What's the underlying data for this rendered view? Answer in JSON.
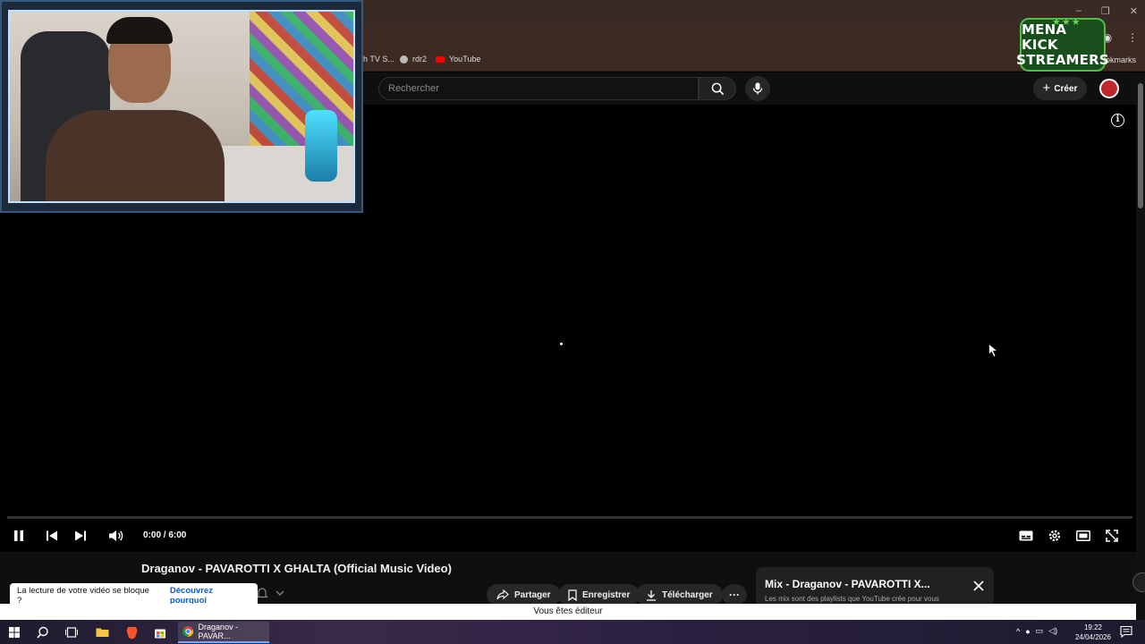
{
  "browser": {
    "bookmarks": [
      {
        "label": "h TV S..."
      },
      {
        "label": "rdr2"
      },
      {
        "label": "YouTube"
      }
    ],
    "bookmarks_right": "ookmarks"
  },
  "youtube": {
    "search_placeholder": "Rechercher",
    "create_label": "Créer"
  },
  "player": {
    "time": "0:00 / 6:00",
    "progress_fraction": 0
  },
  "video": {
    "title": "Draganov - PAVAROTTI X GHALTA (Official Music Video)",
    "actions": {
      "share": "Partager",
      "save": "Enregistrer",
      "download": "Télécharger"
    }
  },
  "mix": {
    "title": "Mix - Draganov - PAVAROTTI X...",
    "subtitle": "Les mix sont des playlists que YouTube crée pour vous"
  },
  "toast": {
    "text": "La lecture de votre vidéo se bloque ?",
    "link": "Découvrez pourquoi"
  },
  "editor_bar": "Vous êtes éditeur",
  "taskbar": {
    "app_label": "Draganov - PAVAR...",
    "time": "19:22",
    "date": "24/04/2026"
  },
  "overlay": {
    "logo_line1": "MENA KICK",
    "logo_line2": "STREAMERS"
  },
  "colors": {
    "yt_bg": "#0f0f0f",
    "accent_red": "#ff0000",
    "link_blue": "#065fd4"
  }
}
